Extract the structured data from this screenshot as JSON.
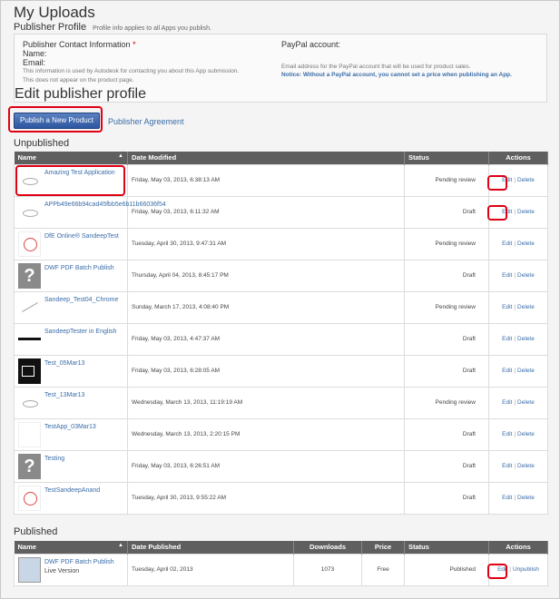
{
  "page": {
    "title": "My Uploads"
  },
  "profile": {
    "heading": "Publisher Profile",
    "note": "Profile info applies to all Apps you publish.",
    "contact_heading": "Publisher Contact Information",
    "required_mark": "*",
    "name_label": "Name:",
    "email_label": "Email:",
    "info_line1": "This information is used by Autodesk for contacting you about this App submission.",
    "info_line2": "This does not appear on the product page.",
    "paypal_heading": "PayPal account:",
    "paypal_info": "Email address for the PayPal account that will be used for product sales.",
    "paypal_notice": "Notice: Without a PayPal account, you cannot set a price when publishing an App.",
    "edit_link": "Edit publisher profile"
  },
  "actions": {
    "publish_button": "Publish a New Product",
    "agreement_link": "Publisher Agreement",
    "edit": "Edit",
    "delete": "Delete",
    "unpublish": "Unpublish",
    "separator": "|"
  },
  "unpublished": {
    "title": "Unpublished",
    "columns": {
      "name": "Name",
      "date": "Date Modified",
      "status": "Status",
      "actions": "Actions"
    },
    "sort_arrow": "▲",
    "rows": [
      {
        "name": "Amazing Test Application",
        "thumb": "oval-icon",
        "date": "Friday, May 03, 2013, 6:38:13 AM",
        "status": "Pending review"
      },
      {
        "name": "APPb49e66b94cad45fbb5e6b11b66036f54",
        "thumb": "oval-icon",
        "date": "Friday, May 03, 2013, 6:11:32 AM",
        "status": "Draft"
      },
      {
        "name": "DfE Online® SandeepTest",
        "thumb": "face-icon",
        "date": "Tuesday, April 30, 2013, 9:47:31 AM",
        "status": "Pending review"
      },
      {
        "name": "DWF PDF Batch Publish",
        "thumb": "question-icon",
        "date": "Thursday, April 04, 2013, 8:45:17 PM",
        "status": "Draft"
      },
      {
        "name": "Sandeep_Test04_Chrome",
        "thumb": "line-icon",
        "date": "Sunday, March 17, 2013, 4:08:40 PM",
        "status": "Pending review"
      },
      {
        "name": "SandeepTester in English",
        "thumb": "bar-icon",
        "date": "Friday, May 03, 2013, 4:47:37 AM",
        "status": "Draft"
      },
      {
        "name": "Test_05Mar13",
        "thumb": "black-icon",
        "date": "Friday, May 03, 2013, 6:28:05 AM",
        "status": "Draft"
      },
      {
        "name": "Test_13Mar13",
        "thumb": "oval-icon",
        "date": "Wednesday, March 13, 2013, 11:19:19 AM",
        "status": "Pending review"
      },
      {
        "name": "TestApp_03Mar13",
        "thumb": "blank-icon",
        "date": "Wednesday, March 13, 2013, 2:20:15 PM",
        "status": "Draft"
      },
      {
        "name": "Testing",
        "thumb": "question-icon",
        "date": "Friday, May 03, 2013, 6:26:51 AM",
        "status": "Draft"
      },
      {
        "name": "TestSandeepAnand",
        "thumb": "face-icon",
        "date": "Tuesday, April 30, 2013, 9:55:22 AM",
        "status": "Draft"
      }
    ]
  },
  "published": {
    "title": "Published",
    "columns": {
      "name": "Name",
      "date": "Date Published",
      "downloads": "Downloads",
      "price": "Price",
      "status": "Status",
      "actions": "Actions"
    },
    "sort_arrow": "▲",
    "rows": [
      {
        "name": "DWF PDF Batch Publish",
        "version": "Live Version",
        "thumb": "package-icon",
        "date": "Tuesday, April 02, 2013",
        "downloads": "1073",
        "price": "Free",
        "status": "Published"
      }
    ]
  },
  "colors": {
    "link": "#3a6da8",
    "header_bg": "#5f5f5f",
    "highlight": "#e00014",
    "button": "#2d56a0"
  }
}
